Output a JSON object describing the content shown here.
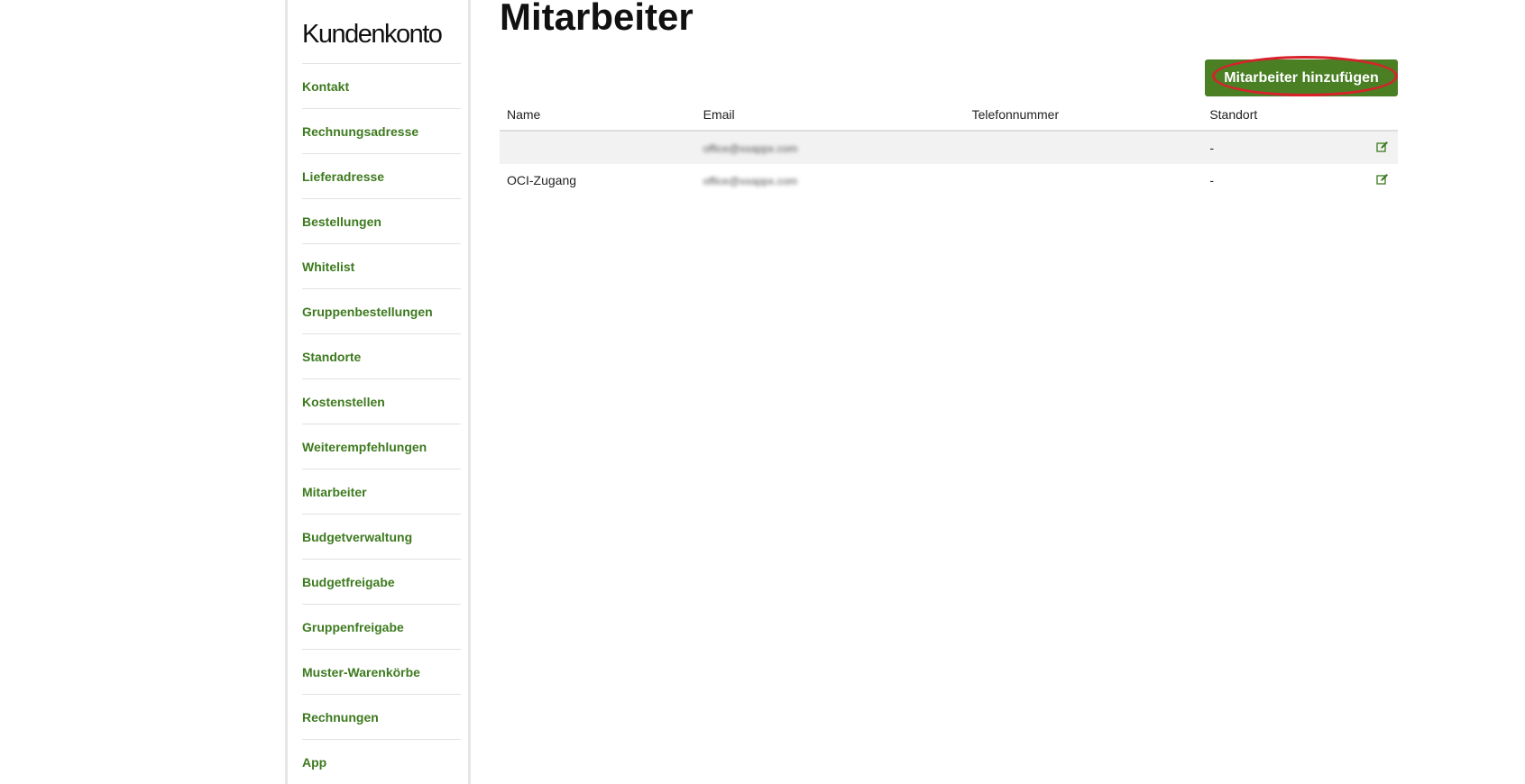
{
  "sidebar": {
    "title": "Kundenkonto",
    "items": [
      {
        "label": "Kontakt"
      },
      {
        "label": "Rechnungsadresse"
      },
      {
        "label": "Lieferadresse"
      },
      {
        "label": "Bestellungen"
      },
      {
        "label": "Whitelist"
      },
      {
        "label": "Gruppenbestellungen"
      },
      {
        "label": "Standorte"
      },
      {
        "label": "Kostenstellen"
      },
      {
        "label": "Weiterempfehlungen"
      },
      {
        "label": "Mitarbeiter"
      },
      {
        "label": "Budgetverwaltung"
      },
      {
        "label": "Budgetfreigabe"
      },
      {
        "label": "Gruppenfreigabe"
      },
      {
        "label": "Muster-Warenkörbe"
      },
      {
        "label": "Rechnungen"
      },
      {
        "label": "App"
      }
    ]
  },
  "main": {
    "title": "Mitarbeiter",
    "add_button_label": "Mitarbeiter hinzufügen",
    "table": {
      "headers": {
        "name": "Name",
        "email": "Email",
        "phone": "Telefonnummer",
        "location": "Standort"
      },
      "rows": [
        {
          "name": "",
          "email": "office@xxappx.com",
          "phone": "",
          "location": "-"
        },
        {
          "name": "OCI-Zugang",
          "email": "office@xxappx.com",
          "phone": "",
          "location": "-"
        }
      ]
    }
  },
  "colors": {
    "accent": "#4a7f24",
    "link": "#3d7a1e",
    "highlight": "#d9212b"
  }
}
